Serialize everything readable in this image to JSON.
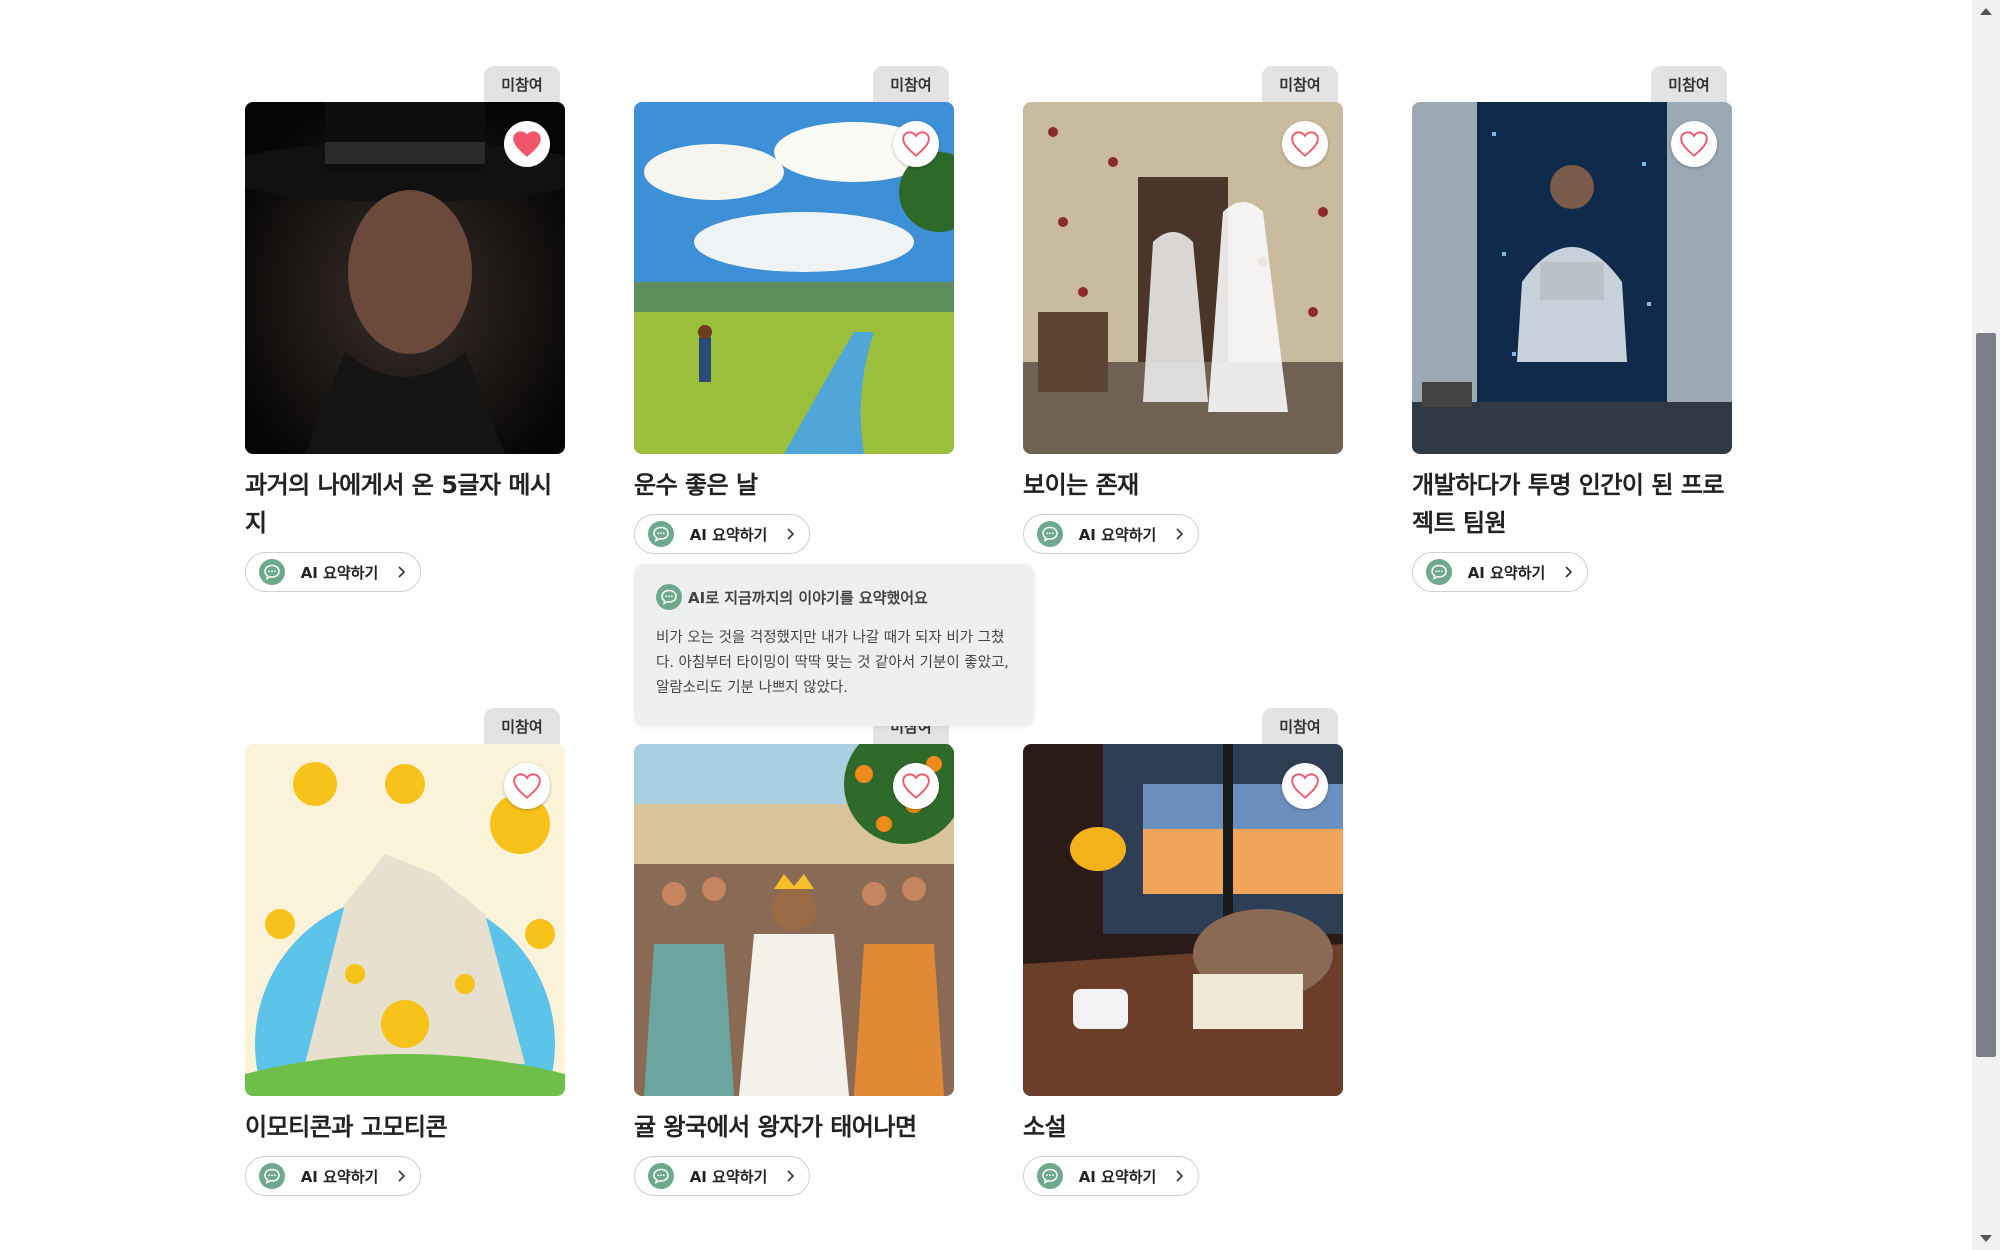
{
  "badge_label": "미참여",
  "ai_button_label": "AI 요약하기",
  "cards": [
    {
      "title": "과거의 나에게서 온 5글자 메시지",
      "liked": true
    },
    {
      "title": "운수 좋은 날",
      "liked": false
    },
    {
      "title": "보이는 존재",
      "liked": false
    },
    {
      "title": "개발하다가 투명 인간이 된 프로젝트 팀원",
      "liked": false
    },
    {
      "title": "이모티콘과 고모티콘",
      "liked": false
    },
    {
      "title": "귤 왕국에서 왕자가 태어나면",
      "liked": false
    },
    {
      "title": "소설",
      "liked": false
    }
  ],
  "summary_popover": {
    "heading": "AI로 지금까지의 이야기를 요약했어요",
    "body": "비가 오는 것을 걱정했지만 내가 나갈 때가 되자 비가 그쳤다. 아침부터 타이밍이 딱딱 맞는 것 같아서 기분이 좋았고, 알람소리도 기분 나쁘지 않았다."
  },
  "colors": {
    "heart": "#f0556a",
    "chat_icon": "#6ea98d",
    "badge_bg": "#e3e3e3"
  },
  "icons": {
    "heart": "heart-icon",
    "chat": "chat-bubble-icon",
    "chevron": "chevron-right-icon"
  }
}
